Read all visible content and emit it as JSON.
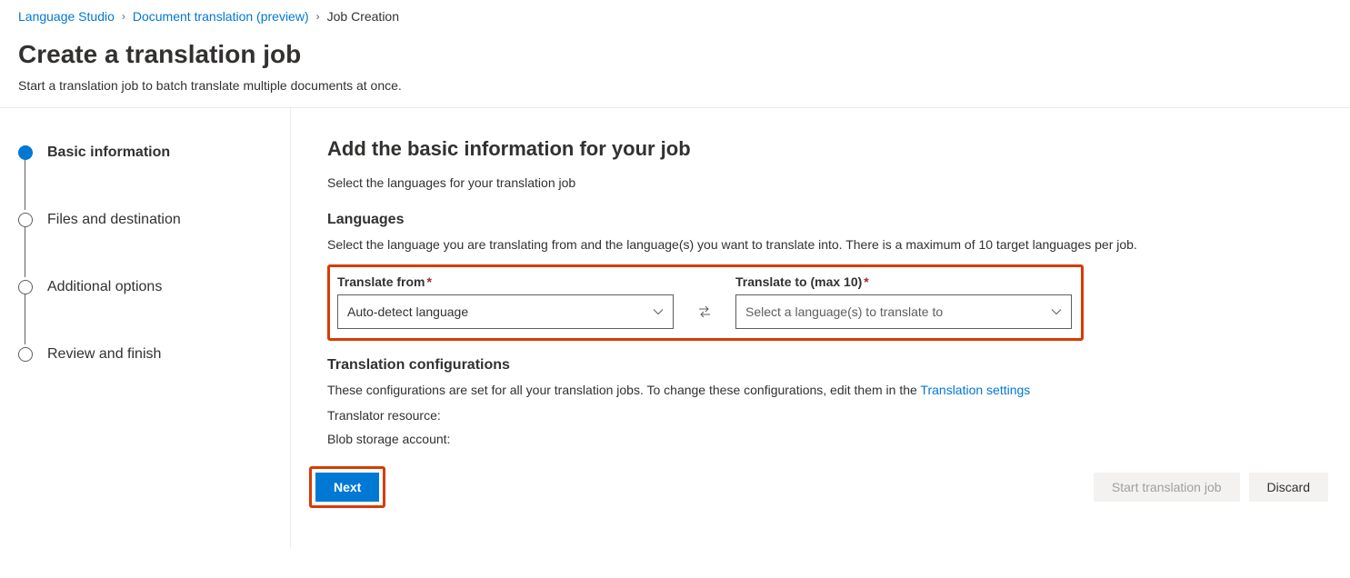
{
  "breadcrumb": {
    "items": [
      {
        "label": "Language Studio",
        "link": true
      },
      {
        "label": "Document translation (preview)",
        "link": true
      },
      {
        "label": "Job Creation",
        "link": false
      }
    ]
  },
  "page": {
    "title": "Create a translation job",
    "subtitle": "Start a translation job to batch translate multiple documents at once."
  },
  "steps": [
    {
      "label": "Basic information",
      "active": true
    },
    {
      "label": "Files and destination",
      "active": false
    },
    {
      "label": "Additional options",
      "active": false
    },
    {
      "label": "Review and finish",
      "active": false
    }
  ],
  "main": {
    "title": "Add the basic information for your job",
    "subtitle": "Select the languages for your translation job",
    "languages": {
      "heading": "Languages",
      "description": "Select the language you are translating from and the language(s) you want to translate into. There is a maximum of 10 target languages per job.",
      "from": {
        "label": "Translate from",
        "value": "Auto-detect language"
      },
      "to": {
        "label": "Translate to (max 10)",
        "placeholder": "Select a language(s) to translate to"
      }
    },
    "config": {
      "heading": "Translation configurations",
      "description_prefix": "These configurations are set for all your translation jobs. To change these configurations, edit them in the ",
      "link_text": "Translation settings",
      "rows": {
        "translator_resource": "Translator resource:",
        "blob_storage": "Blob storage account:"
      }
    }
  },
  "footer": {
    "next": "Next",
    "start": "Start translation job",
    "discard": "Discard"
  }
}
